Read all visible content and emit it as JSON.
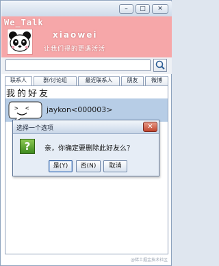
{
  "window": {
    "title": "",
    "controls": {
      "minimize": "–",
      "maximize": "□",
      "close": "✕"
    }
  },
  "profile": {
    "app_name": "We_Talk",
    "username": "xiaowei",
    "signature": "让我们得的更遇活活"
  },
  "search": {
    "value": "",
    "placeholder": "",
    "button_icon": "search-icon"
  },
  "tabs": [
    {
      "label": "联系人",
      "active": true
    },
    {
      "label": "群/讨论组",
      "active": false
    },
    {
      "label": "最近联系人",
      "active": false
    },
    {
      "label": "朋友",
      "active": false
    },
    {
      "label": "微博",
      "active": false
    }
  ],
  "contacts": {
    "group_label": "我的好友",
    "items": [
      {
        "name": "jaykon<000003>"
      }
    ]
  },
  "dialog": {
    "title": "选择一个选项",
    "close": "✕",
    "icon": "question-icon",
    "icon_glyph": "?",
    "message": "亲，你确定要删除此好友么？",
    "buttons": {
      "yes": "是(Y)",
      "no": "否(N)",
      "cancel": "取消"
    }
  },
  "watermark": "@稀土掘金技术社区",
  "colors": {
    "profile_bg": "#f6a7a9",
    "selected_row": "#b7cde6",
    "dialog_bg": "#e6edf6",
    "question_icon": "#5aa32f"
  }
}
